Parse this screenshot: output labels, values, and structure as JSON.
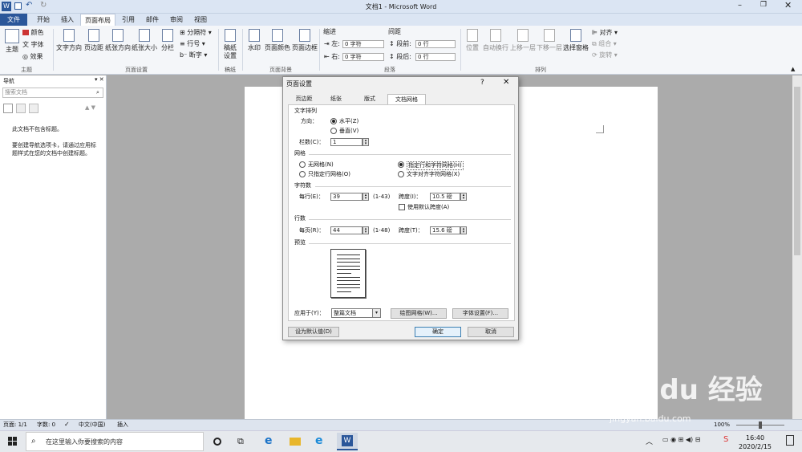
{
  "window": {
    "title": "文档1 - Microsoft Word"
  },
  "tabs": [
    "文件",
    "开始",
    "插入",
    "页面布局",
    "引用",
    "邮件",
    "审阅",
    "视图"
  ],
  "ribbon": {
    "theme": {
      "main": "主题",
      "colors": "颜色",
      "fonts": "字体",
      "effects": "效果",
      "group": "主题"
    },
    "page_setup": {
      "text_direction": "文字方向",
      "margins": "页边距",
      "orientation": "纸张方向",
      "size": "纸张大小",
      "columns": "分栏",
      "breaks": "分隔符",
      "line_numbers": "行号",
      "hyphenation": "断字",
      "group": "页面设置"
    },
    "draft": {
      "label": "稿纸设置",
      "group": "稿纸"
    },
    "page_background": {
      "watermark": "水印",
      "page_color": "页面颜色",
      "page_borders": "页面边框",
      "group": "页面背景"
    },
    "paragraph": {
      "indent": "缩进",
      "spacing": "间距",
      "left": "左:",
      "right": "右:",
      "before": "段前:",
      "after": "段后:",
      "indent_left_val": "0 字符",
      "indent_right_val": "0 字符",
      "before_val": "0 行",
      "after_val": "0 行",
      "group": "段落"
    },
    "arrange": {
      "position": "位置",
      "wrap": "自动换行",
      "bring_forward": "上移一层",
      "send_backward": "下移一层",
      "selection_pane": "选择窗格",
      "align": "对齐",
      "group_obj": "组合",
      "rotate": "旋转",
      "group": "排列"
    }
  },
  "nav_pane": {
    "title": "导航",
    "search_placeholder": "搜索文档",
    "msg1": "此文档不包含标题。",
    "msg2": "要创建导航选项卡，请通过应用标题样式在您的文档中创建标题。"
  },
  "dialog": {
    "title": "页面设置",
    "help": "?",
    "tabs": [
      "页边距",
      "纸张",
      "版式",
      "文档网格"
    ],
    "text_layout": "文字排列",
    "direction_label": "方向：",
    "horizontal": "水平(Z)",
    "vertical": "垂直(V)",
    "columns_label": "栏数(C)：",
    "columns_val": "1",
    "grid_label": "网格",
    "no_grid": "无网格(N)",
    "line_grid_only": "只指定行网格(O)",
    "line_char_grid": "指定行和字符网格(H)",
    "snap_chars": "文字对齐字符网格(X)",
    "chars_section": "字符数",
    "per_line": "每行(E)：",
    "per_line_val": "39",
    "per_line_range": "(1-43)",
    "pitch_label": "跨度(I)：",
    "char_pitch_val": "10.5 磅",
    "use_default_pitch": "使用默认跨度(A)",
    "lines_section": "行数",
    "per_page": "每页(R)：",
    "per_page_val": "44",
    "per_page_range": "(1-48)",
    "line_pitch_label": "跨度(T)：",
    "line_pitch_val": "15.6 磅",
    "preview": "预览",
    "apply_to": "应用于(Y)：",
    "apply_val": "整篇文档",
    "drawing_grid": "绘图网格(W)...",
    "font_settings": "字体设置(F)...",
    "set_default": "设为默认值(D)",
    "ok": "确定",
    "cancel": "取消"
  },
  "status": {
    "page": "页面: 1/1",
    "words": "字数: 0",
    "lang": "中文(中国)",
    "mode": "插入",
    "zoom": "100%"
  },
  "taskbar": {
    "search": "在这里输入你要搜索的内容",
    "time": "16:40",
    "date": "2020/2/15"
  },
  "watermark": {
    "brand": "Bai du 经验",
    "url": "jingyan.baidu.com"
  }
}
